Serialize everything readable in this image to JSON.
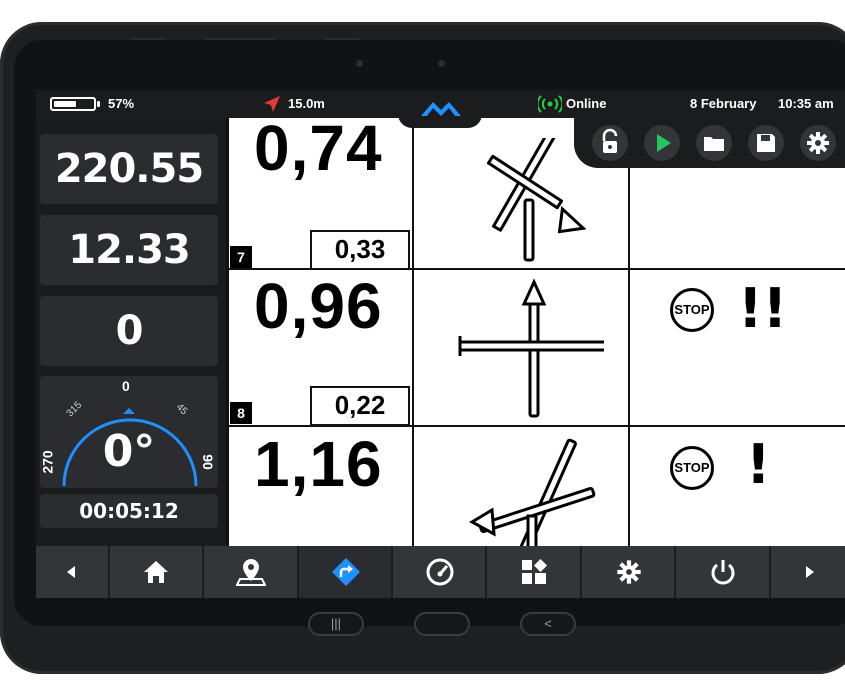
{
  "status_bar": {
    "battery_percent": "57%",
    "battery_level": 0.57,
    "gps_accuracy": "15.0m",
    "connection_status": "Online",
    "date": "8 February",
    "time": "10:35 am"
  },
  "toolbar": {
    "icons": [
      "unlock-icon",
      "play-icon",
      "folder-icon",
      "save-icon",
      "gear-icon"
    ]
  },
  "left_panel": {
    "value_1": "220.55",
    "value_2": "12.33",
    "value_3": "0",
    "compass": {
      "heading": "0°",
      "label_top": "0",
      "label_nw": "315",
      "label_ne": "45",
      "label_left": "270",
      "label_right": "90"
    },
    "timer": "00:05:12"
  },
  "grid": {
    "rows": [
      {
        "big_value": "0,74",
        "small_value": "0,33",
        "row_number": "7",
        "sign": "",
        "sign_icon": ""
      },
      {
        "big_value": "0,96",
        "small_value": "0,22",
        "row_number": "8",
        "sign": "STOP",
        "alert": "!!"
      },
      {
        "big_value": "1,16",
        "small_value": "",
        "row_number": "",
        "sign": "STOP",
        "alert": "!"
      }
    ]
  },
  "nav": {
    "items": [
      "prev-arrow-icon",
      "home-icon",
      "location-icon",
      "route-icon",
      "gauge-icon",
      "grid-icon",
      "settings-icon",
      "power-icon",
      "next-arrow-icon"
    ],
    "active_index": 3
  },
  "colors": {
    "accent": "#1e90ff",
    "online_green": "#2ecc40",
    "play_green": "#22c55e",
    "gps_red": "#e53935"
  }
}
